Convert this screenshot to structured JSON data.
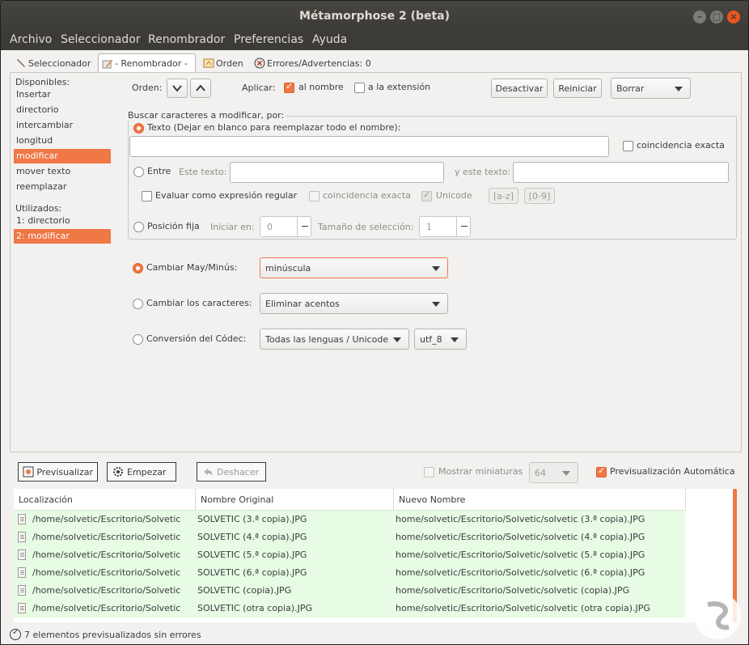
{
  "window": {
    "title": "Métamorphose 2 (beta)"
  },
  "menu": [
    "Archivo",
    "Seleccionador",
    "Renombrador",
    "Preferencias",
    "Ayuda"
  ],
  "tabs": [
    {
      "label": "Seleccionador",
      "icon": "wrench-icon"
    },
    {
      "label": "- Renombrador -",
      "icon": "pencil-icon"
    },
    {
      "label": "Orden",
      "icon": "sort-icon"
    },
    {
      "label": "Errores/Advertencias: 0",
      "icon": "error-icon"
    }
  ],
  "sidebar": {
    "available_header": "Disponibles:",
    "available": [
      "Insertar",
      "directorio",
      "intercambiar",
      "longitud",
      "modificar",
      "mover texto",
      "reemplazar"
    ],
    "available_selected": "modificar",
    "used_header": "Utilizados:",
    "used": [
      "1: directorio",
      "2: modificar"
    ],
    "used_selected": "2: modificar"
  },
  "toolbar": {
    "order_label": "Orden:",
    "apply_label": "Aplicar:",
    "to_name_label": "al nombre",
    "to_name_checked": true,
    "to_ext_label": "a la extensión",
    "to_ext_checked": false,
    "disable_label": "Desactivar",
    "reset_label": "Reiniciar",
    "delete_value": "Borrar"
  },
  "search": {
    "legend": "Buscar caracteres a modificar, por:",
    "text_label": "Texto (Dejar en blanco para reemplazar todo el nombre):",
    "text_value": "",
    "exact_match_label": "coincidencia exacta",
    "between_label": "Entre",
    "this_text_label": "Este texto:",
    "and_this_text_label": "y este texto:",
    "regex_label": "Evaluar como expresión regular",
    "exact_match2_label": "coincidencia exacta",
    "unicode_label": "Unicode",
    "az_label": "[a-z]",
    "digits_label": "[0-9]",
    "fixed_pos_label": "Posición fija",
    "start_at_label": "Iniciar en:",
    "start_at_value": "0",
    "sel_size_label": "Tamaño de selección:",
    "sel_size_value": "1"
  },
  "options": {
    "case_label": "Cambiar May/Minús:",
    "case_value": "minúscula",
    "chars_label": "Cambiar los caracteres:",
    "chars_value": "Eliminar acentos",
    "codec_label": "Conversión del Códec:",
    "codec_value": "Todas las lenguas / Unicode",
    "codec_enc_value": "utf_8"
  },
  "bottom": {
    "preview_label": "Previsualizar",
    "start_label": "Empezar",
    "undo_label": "Deshacer",
    "thumbs_label": "Mostrar miniaturas",
    "thumbs_size": "64",
    "auto_preview_label": "Previsualización Automática"
  },
  "table": {
    "headers": [
      "Localización",
      "Nombre Original",
      "Nuevo Nombre"
    ],
    "rows": [
      [
        "/home/solvetic/Escritorio/Solvetic",
        "SOLVETIC (3.ª copia).JPG",
        "home/solvetic/Escritorio/Solvetic/solvetic (3.ª copia).JPG"
      ],
      [
        "/home/solvetic/Escritorio/Solvetic",
        "SOLVETIC (4.ª copia).JPG",
        "home/solvetic/Escritorio/Solvetic/solvetic (4.ª copia).JPG"
      ],
      [
        "/home/solvetic/Escritorio/Solvetic",
        "SOLVETIC (5.ª copia).JPG",
        "home/solvetic/Escritorio/Solvetic/solvetic (5.ª copia).JPG"
      ],
      [
        "/home/solvetic/Escritorio/Solvetic",
        "SOLVETIC (6.ª copia).JPG",
        "home/solvetic/Escritorio/Solvetic/solvetic (6.ª copia).JPG"
      ],
      [
        "/home/solvetic/Escritorio/Solvetic",
        "SOLVETIC (copia).JPG",
        "home/solvetic/Escritorio/Solvetic/solvetic (copia).JPG"
      ],
      [
        "/home/solvetic/Escritorio/Solvetic",
        "SOLVETIC (otra copia).JPG",
        "home/solvetic/Escritorio/Solvetic/solvetic (otra copia).JPG"
      ]
    ]
  },
  "status": {
    "text": "7 elementos previsualizados sin errores"
  },
  "colors": {
    "accent": "#f07746",
    "titlebar": "#3c3b37",
    "row_ok": "#e7fbe5"
  }
}
